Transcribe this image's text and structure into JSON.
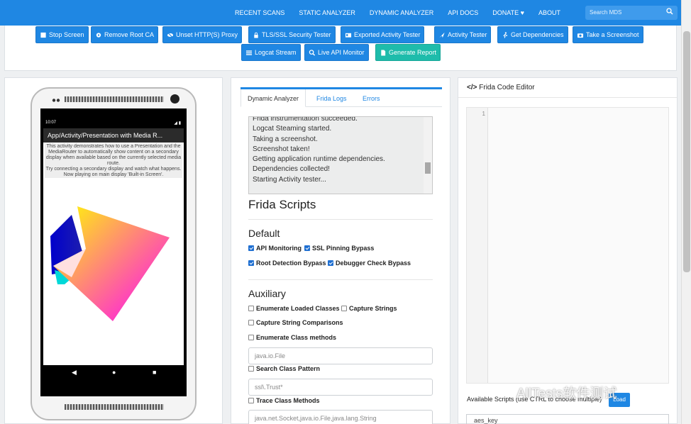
{
  "navbar": {
    "links": [
      "RECENT SCANS",
      "STATIC ANALYZER",
      "DYNAMIC ANALYZER",
      "API DOCS",
      "DONATE ♥",
      "ABOUT"
    ],
    "search_placeholder": "Search MDS"
  },
  "actions": {
    "row1": [
      "Stop Screen",
      "Remove Root CA",
      "Unset HTTP(S) Proxy",
      "TLS/SSL Security Tester",
      "Exported Activity Tester",
      "Activity Tester",
      "Get Dependencies",
      "Take a Screenshot"
    ],
    "row2": [
      "Logcat Stream",
      "Live API Monitor",
      "Generate Report"
    ]
  },
  "phone": {
    "time": "10:07",
    "app_title": "App/Activity/Presentation with Media R...",
    "text1": "This activity demonstrates how to use a Presentation and the MediaRouter to automatically show content on a secondary display when available based on the currently selected media route.",
    "text2": "Try connecting a secondary display and watch what happens.",
    "text3": "Now playing on main display 'Built-in Screen'.",
    "nav": [
      "◀",
      "●",
      "■"
    ]
  },
  "analyzer": {
    "tabs": [
      "Dynamic Analyzer",
      "Frida Logs",
      "Errors"
    ],
    "log_lines": [
      "Frida instrumentation succeeded.",
      "Logcat Steaming started.",
      "Taking a screenshot.",
      "Screenshot taken!",
      "Getting application runtime dependencies.",
      "Dependencies collected!",
      "Starting Activity tester..."
    ],
    "frida_title": "Frida Scripts",
    "default_title": "Default",
    "default_scripts": [
      "API Monitoring",
      "SSL Pinning Bypass",
      "Root Detection Bypass",
      "Debugger Check Bypass"
    ],
    "auxiliary_title": "Auxiliary",
    "aux": {
      "enum_classes": "Enumerate Loaded Classes",
      "capture_strings": "Capture Strings",
      "capture_comparisons": "Capture String Comparisons",
      "enum_methods": "Enumerate Class methods",
      "enum_methods_placeholder": "java.io.File",
      "search_pattern": "Search Class Pattern",
      "search_pattern_placeholder": "ssl\\.Trust*",
      "trace_methods": "Trace Class Methods",
      "trace_methods_placeholder": "java.net.Socket,java.io.File,java.lang.String"
    }
  },
  "editor": {
    "title": "Frida Code Editor",
    "line_number": "1",
    "available_label": "Available Scripts (use CTRL to choose multiple)",
    "load_label": "Load",
    "first_script": "aes_key"
  },
  "watermark": "AllTests软件测试"
}
